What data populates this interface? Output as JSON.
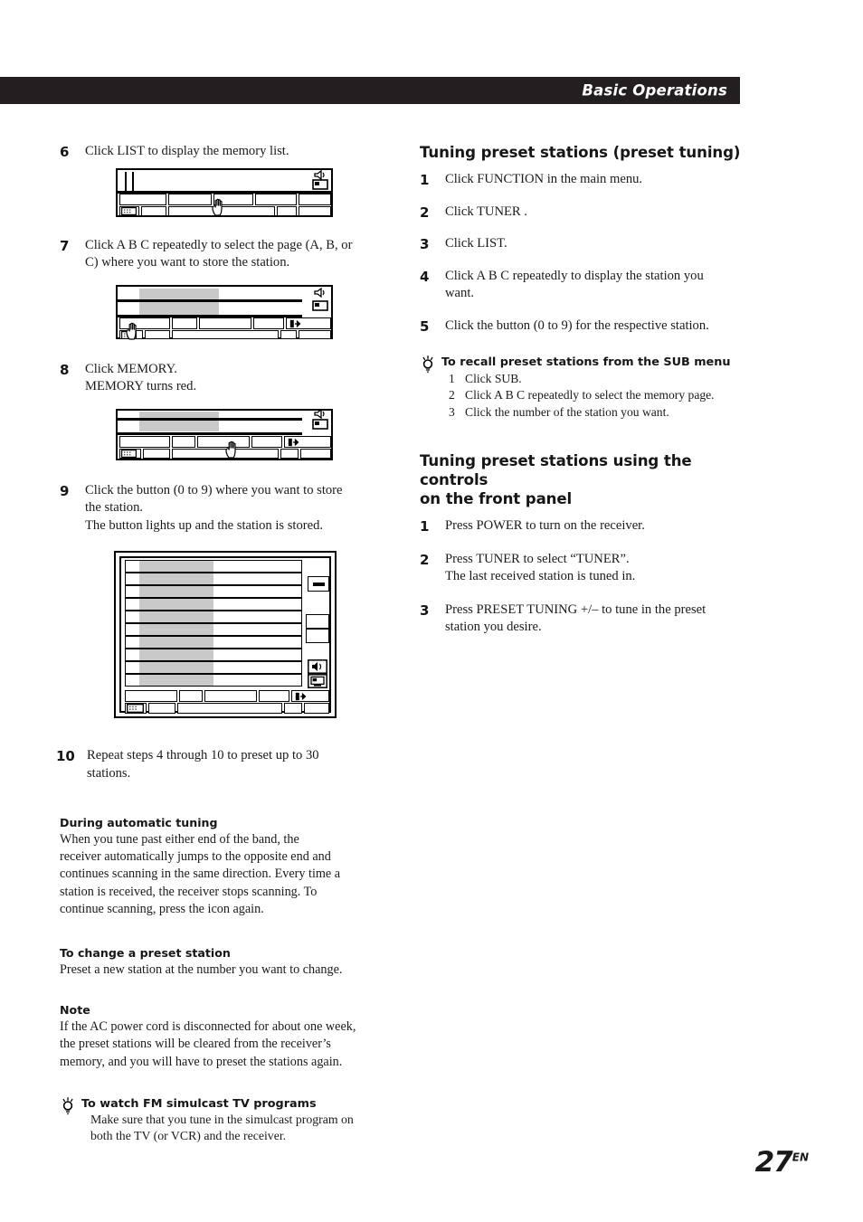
{
  "header": {
    "band_title": "Basic Operations",
    "band_color": "#231f20"
  },
  "page": {
    "number": "27",
    "locale_suffix": "EN"
  },
  "left_column": {
    "steps": [
      {
        "num": "6",
        "lines": [
          "Click LIST to display the memory list."
        ],
        "diagram": "tuner-panel-list"
      },
      {
        "num": "7",
        "lines": [
          "Click A B C repeatedly to select the page (A, B, or",
          "C) where you want to store the station."
        ],
        "diagram": "tuner-panel-abc"
      },
      {
        "num": "8",
        "lines": [
          "Click MEMORY.",
          "MEMORY turns red."
        ],
        "diagram": "tuner-panel-memory"
      },
      {
        "num": "9",
        "lines": [
          "Click the button (0 to 9) where you want to store",
          "the station.",
          "The button lights up and the station is stored."
        ],
        "diagram": "memory-list-panel"
      },
      {
        "num": "10",
        "lines": [
          "Repeat steps 4 through 10 to preset up to 30",
          "stations."
        ],
        "diagram": null
      }
    ],
    "notes": [
      {
        "title": "During automatic tuning",
        "lines": [
          "When you tune past either end of the band, the",
          "receiver automatically jumps to the opposite end and",
          "continues scanning in the same direction. Every time a",
          "station is received, the receiver stops scanning. To",
          "continue scanning, press the icon again."
        ]
      },
      {
        "title": "To change a preset station",
        "lines": [
          "Preset a new station at the number you want to change."
        ]
      },
      {
        "title": "Note",
        "lines": [
          "If the AC power cord is disconnected for about one week,",
          "the preset stations will be cleared from the receiver’s",
          "memory, and you will have to preset the stations again."
        ]
      }
    ],
    "tip": {
      "icon": "lightbulb-icon",
      "title": "To watch FM simulcast TV programs",
      "lines": [
        "Make sure that you tune in the simulcast program on",
        "both the TV (or VCR) and the receiver."
      ]
    }
  },
  "right_column": {
    "section_one": {
      "heading": "Tuning preset stations (preset tuning)",
      "steps": [
        {
          "num": "1",
          "lines": [
            "Click FUNCTION in the main menu."
          ]
        },
        {
          "num": "2",
          "lines": [
            "Click TUNER ."
          ]
        },
        {
          "num": "3",
          "lines": [
            "Click LIST."
          ]
        },
        {
          "num": "4",
          "lines": [
            "Click A B C repeatedly to display the station you",
            "want."
          ]
        },
        {
          "num": "5",
          "lines": [
            "Click the button (0 to 9) for the respective station."
          ]
        }
      ]
    },
    "tip": {
      "icon": "lightbulb-icon",
      "title": "To recall preset stations from the SUB menu",
      "items": [
        {
          "n": "1",
          "text": "Click SUB."
        },
        {
          "n": "2",
          "text": "Click A B C repeatedly to select the memory page."
        },
        {
          "n": "3",
          "text": "Click the number of the station you want."
        }
      ]
    },
    "section_two": {
      "heading_lines": [
        "Tuning preset stations using the controls",
        "on the front panel"
      ],
      "steps": [
        {
          "num": "1",
          "lines": [
            "Press POWER to turn on the receiver."
          ]
        },
        {
          "num": "2",
          "lines": [
            "Press TUNER to select “TUNER”.",
            "The last received station is tuned in."
          ]
        },
        {
          "num": "3",
          "lines": [
            "Press PRESET TUNING +/– to tune in the preset",
            "station you desire."
          ]
        }
      ]
    }
  },
  "diagram_icons": {
    "speaker": "speaker-icon",
    "monitor": "monitor-icon",
    "exit": "exit-arrow-icon",
    "keypad": "keypad-icon",
    "dash": "dash-button-icon",
    "cursor": "hand-cursor-icon"
  },
  "colors": {
    "shade": "#c9c9c9",
    "ink": "#000000",
    "band": "#231f20"
  }
}
